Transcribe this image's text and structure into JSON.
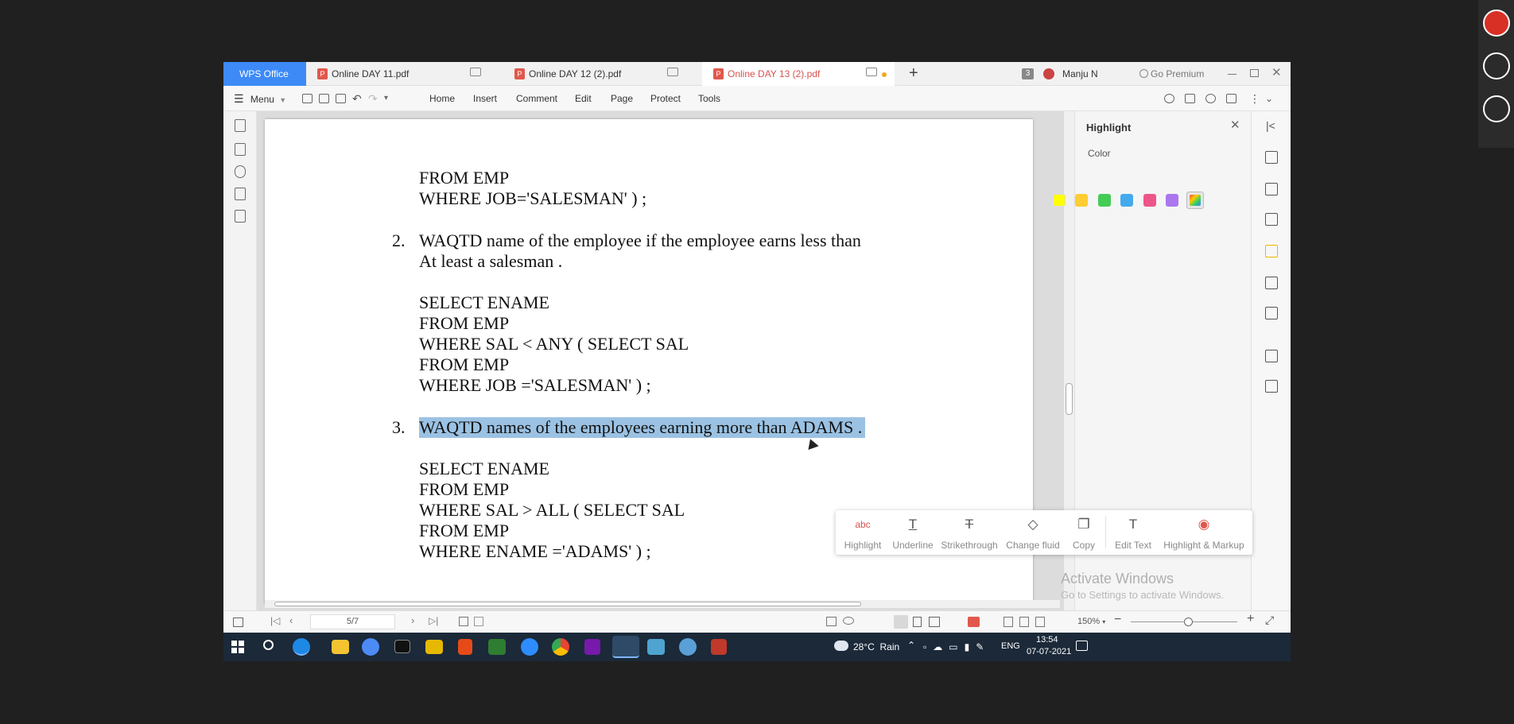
{
  "app": {
    "name": "WPS Office"
  },
  "tabs": [
    {
      "label": "Online DAY 11.pdf"
    },
    {
      "label": "Online DAY 12 (2).pdf"
    },
    {
      "label": "Online DAY 13 (2).pdf"
    }
  ],
  "tabbar": {
    "new_tab": "+",
    "count_badge": "3",
    "user": "Manju N",
    "premium": "Go Premium"
  },
  "toolbar": {
    "menu": "Menu",
    "items": [
      "Home",
      "Insert",
      "Comment",
      "Edit",
      "Page",
      "Protect",
      "Tools"
    ]
  },
  "document": {
    "lines": [
      "FROM EMP",
      "WHERE JOB='SALESMAN' ) ;",
      "WAQTD name of the employee if the employee earns less than",
      "At least a salesman .",
      "SELECT ENAME",
      "FROM EMP",
      "WHERE SAL < ANY ( SELECT SAL",
      "FROM EMP",
      "WHERE JOB ='SALESMAN' ) ;",
      "WAQTD names of the employees earning more than ADAMS .",
      "SELECT ENAME",
      "FROM EMP",
      "WHERE SAL > ALL  ( SELECT SAL",
      "FROM EMP",
      "WHERE ENAME ='ADAMS' ) ;"
    ],
    "numbers": [
      "2.",
      "3."
    ]
  },
  "popup": {
    "items": [
      "Highlight",
      "Underline",
      "Strikethrough",
      "Change fluid",
      "Copy",
      "Edit Text",
      "Highlight & Markup"
    ]
  },
  "panel": {
    "title": "Highlight",
    "color_label": "Color",
    "colors": [
      "#ffff00",
      "#ffcc33",
      "#44cc55",
      "#44aaee",
      "#ee5588",
      "#aa77ee",
      "multi"
    ]
  },
  "watermark": {
    "title": "Activate Windows",
    "subtitle": "Go to Settings to activate Windows."
  },
  "status": {
    "page": "5/7",
    "zoom": "150%"
  },
  "taskbar": {
    "weather": "28°C  Rain",
    "lang": "ENG",
    "time": "13:54",
    "date": "07-07-2021"
  }
}
